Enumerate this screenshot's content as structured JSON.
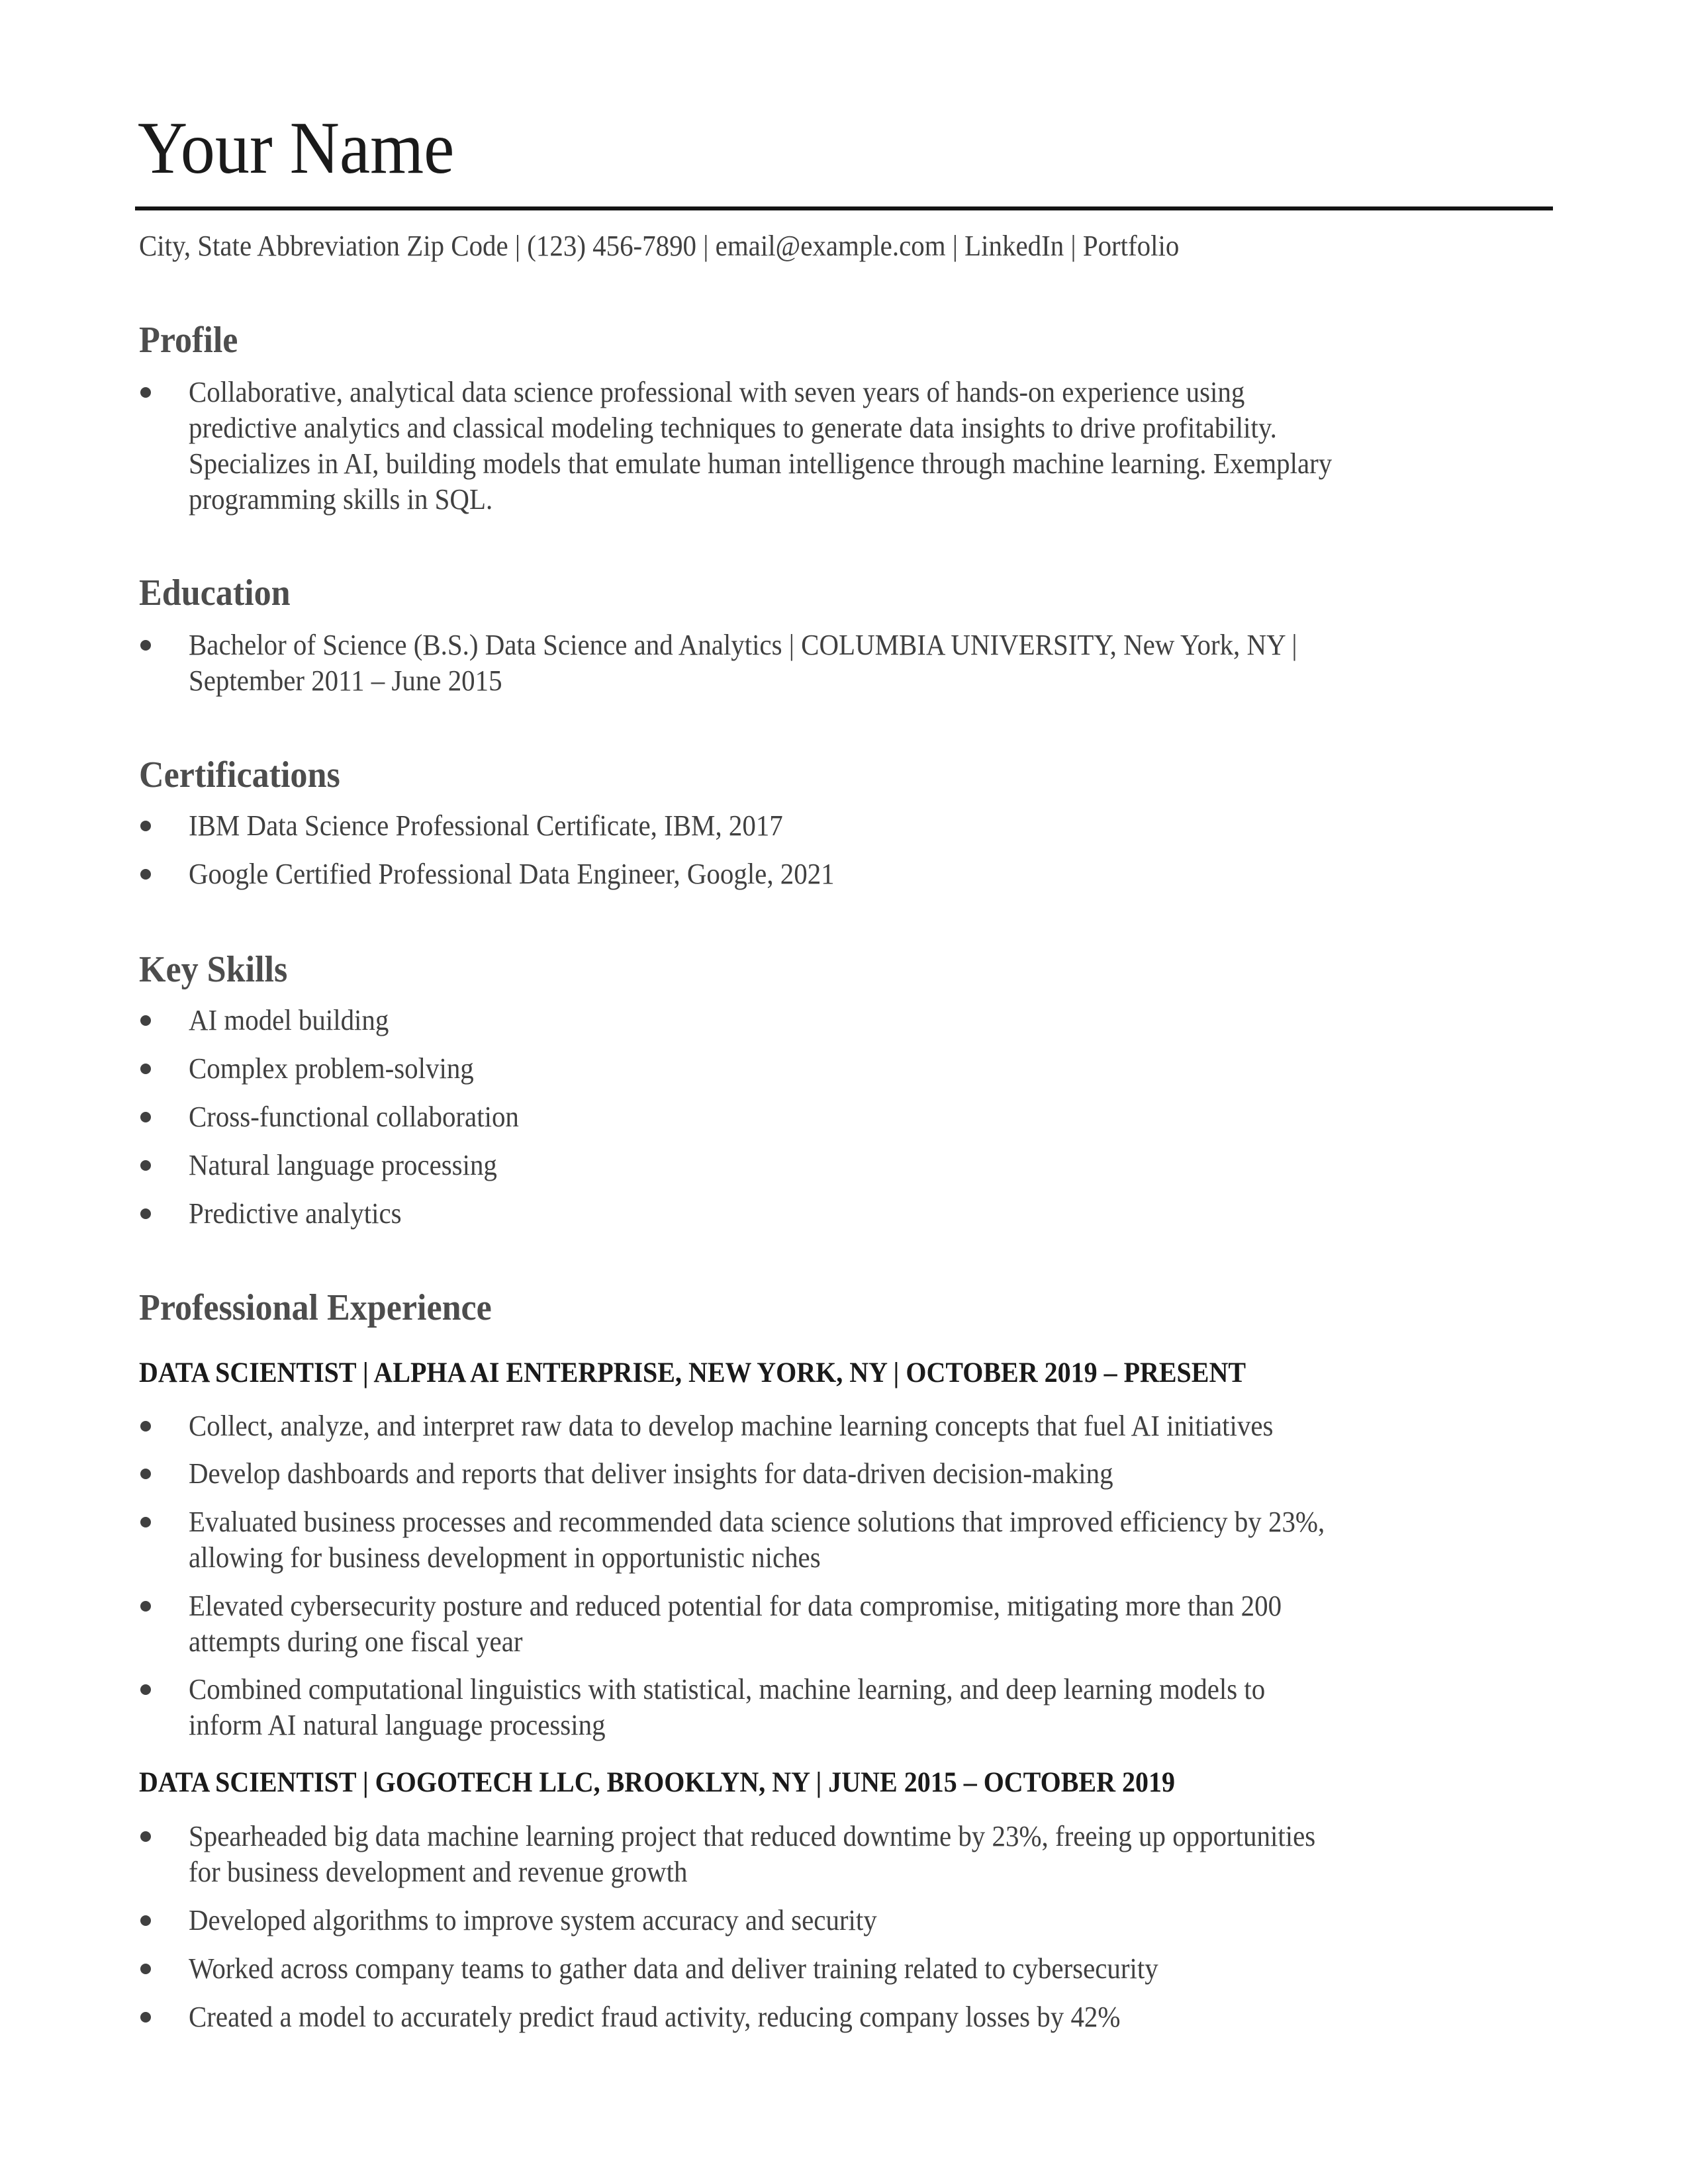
{
  "header": {
    "name": "Your Name",
    "contact": "City, State Abbreviation Zip Code | (123) 456-7890 | email@example.com | LinkedIn | Portfolio"
  },
  "profile": {
    "title": "Profile",
    "items": [
      {
        "lines": [
          "Collaborative, analytical data science professional with seven years of hands-on experience using",
          "predictive analytics and classical modeling techniques to generate data insights to drive profitability.",
          "Specializes in AI, building models that emulate human intelligence through machine learning. Exemplary",
          "programming skills in SQL."
        ]
      }
    ]
  },
  "education": {
    "title": "Education",
    "items": [
      {
        "lines": [
          "Bachelor of Science (B.S.) Data Science and Analytics | COLUMBIA UNIVERSITY, New York, NY |",
          "September 2011 – June 2015"
        ]
      }
    ]
  },
  "certifications": {
    "title": "Certifications",
    "items": [
      {
        "lines": [
          "IBM Data Science Professional Certificate, IBM, 2017"
        ]
      },
      {
        "lines": [
          "Google Certified Professional Data Engineer, Google, 2021"
        ]
      }
    ]
  },
  "skills": {
    "title": "Key Skills",
    "items": [
      {
        "lines": [
          "AI model building"
        ]
      },
      {
        "lines": [
          "Complex problem-solving"
        ]
      },
      {
        "lines": [
          "Cross-functional collaboration"
        ]
      },
      {
        "lines": [
          "Natural language processing"
        ]
      },
      {
        "lines": [
          "Predictive analytics"
        ]
      }
    ]
  },
  "experience": {
    "title": "Professional Experience",
    "jobs": [
      {
        "title": "DATA SCIENTIST | ALPHA AI ENTERPRISE, NEW YORK, NY | OCTOBER 2019 – PRESENT",
        "items": [
          {
            "lines": [
              "Collect, analyze, and interpret raw data to develop machine learning concepts that fuel AI initiatives"
            ]
          },
          {
            "lines": [
              "Develop dashboards and reports that deliver insights for data-driven decision-making"
            ]
          },
          {
            "lines": [
              "Evaluated business processes and recommended data science solutions that improved efficiency by 23%,",
              "allowing for business development in opportunistic niches"
            ]
          },
          {
            "lines": [
              "Elevated cybersecurity posture and reduced potential for data compromise, mitigating more than 200",
              "attempts during one fiscal year"
            ]
          },
          {
            "lines": [
              "Combined computational linguistics with statistical, machine learning, and deep learning models to",
              "inform AI natural language processing"
            ]
          }
        ]
      },
      {
        "title": "DATA SCIENTIST | GOGOTECH LLC, BROOKLYN, NY | JUNE 2015 – OCTOBER 2019",
        "items": [
          {
            "lines": [
              "Spearheaded big data machine learning project that reduced downtime by 23%, freeing up opportunities",
              "for business development and revenue growth"
            ]
          },
          {
            "lines": [
              "Developed algorithms to improve system accuracy and security"
            ]
          },
          {
            "lines": [
              "Worked across company teams to gather data and deliver training related to cybersecurity"
            ]
          },
          {
            "lines": [
              "Created a model to accurately predict fraud activity, reducing company losses by 42%"
            ]
          }
        ]
      }
    ]
  }
}
